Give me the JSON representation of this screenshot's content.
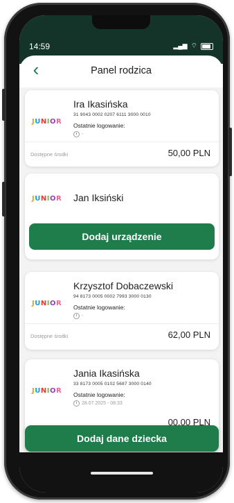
{
  "status": {
    "time": "14:59",
    "signal": "…∥",
    "wifi": "▾"
  },
  "header": {
    "title": "Panel rodzica",
    "back_icon": "chevron-left-icon"
  },
  "logo_text": [
    "J",
    "U",
    "N",
    "I",
    "O",
    "R"
  ],
  "children": [
    {
      "name": "Ira Ikasińska",
      "account": "31 9043 0002 0207 6111 3000 0010",
      "last_login_label": "Ostatnie logowanie:",
      "last_login_value": "-",
      "funds_label": "Dostępne środki",
      "funds_value": "50,00 PLN"
    },
    {
      "name": "Jan Iksiński",
      "add_device_label": "Dodaj urządzenie"
    },
    {
      "name": "Krzysztof Dobaczewski",
      "account": "94 8173 0005 0002 7993 3000 0130",
      "last_login_label": "Ostatnie logowanie:",
      "last_login_value": "-",
      "funds_label": "Dostępne środki",
      "funds_value": "62,00 PLN"
    },
    {
      "name": "Jania Ikasińska",
      "account": "33 8173 0005 0102 5687 3000 0140",
      "last_login_label": "Ostatnie logowanie:",
      "last_login_value": "28.07.2025 - 08:33",
      "funds_value": "00,00 PLN"
    }
  ],
  "add_child_label": "Dodaj dane dziecka",
  "colors": {
    "brand_green": "#1f7d4c",
    "status_bar": "#14342a"
  }
}
